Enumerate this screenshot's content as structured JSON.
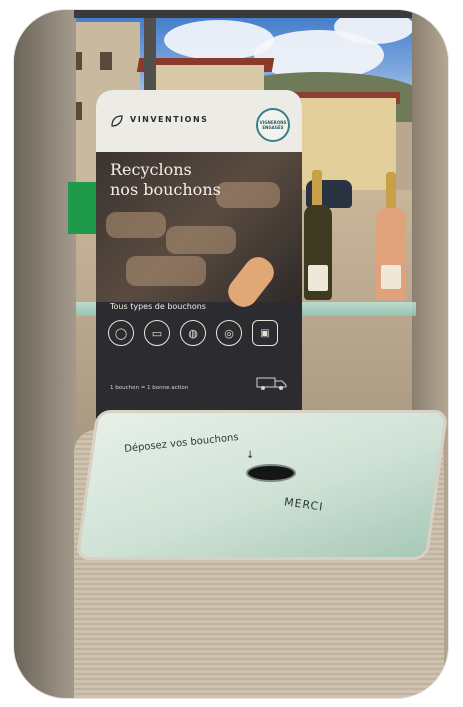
{
  "sign": {
    "brand": "VINVENTIONS",
    "badge_text": "VIGNERONS ENGAGÉS",
    "headline_line1": "Recyclons",
    "headline_line2": "nos bouchons",
    "subtitle": "Tous types de bouchons",
    "tagline": "1 bouchon = 1 bonne action"
  },
  "bin": {
    "instruction": "Déposez vos bouchons",
    "arrow": "↓",
    "thanks": "MERCI"
  },
  "icons": [
    "cork-icon",
    "synthetic-cork-icon",
    "champagne-cork-icon",
    "screwcap-icon",
    "bin-icon"
  ],
  "colors": {
    "sign_dark": "#2c2c30",
    "sign_light": "#ecebe6",
    "lid_green": "#cfe2d6",
    "bin_beige": "#cfc2b0",
    "shelf_glass": "#8fc7b8"
  }
}
